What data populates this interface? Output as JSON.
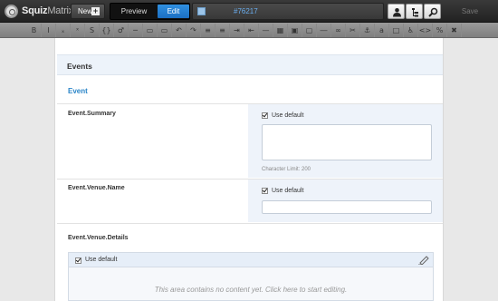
{
  "app": {
    "logo_bold": "Squiz",
    "logo_thin": "Matrix"
  },
  "topbar": {
    "new_label": "New",
    "preview_label": "Preview",
    "edit_label": "Edit",
    "asset_id": "#76217",
    "save_label": "Save",
    "icons": [
      "user-icon",
      "tree-icon",
      "search-icon"
    ]
  },
  "wysiwyg": {
    "buttons": [
      "B",
      "I",
      "ₓ",
      "ˣ",
      "S",
      "{}",
      "♂",
      "─",
      "▭",
      "▭",
      "↶",
      "↷",
      "≡",
      "≡",
      "⇥",
      "⇤",
      "—",
      "▦",
      "▣",
      "▢",
      "―",
      "∞",
      "✂",
      "⚓",
      "a",
      "□",
      "♿",
      "<>",
      "%",
      "✖"
    ]
  },
  "page": {
    "section_title": "Events",
    "subsection_title": "Event",
    "fields": {
      "summary": {
        "label": "Event.Summary",
        "checkbox_label": "Use default",
        "char_limit": "Character Limit: 200"
      },
      "venue_name": {
        "label": "Event.Venue.Name",
        "checkbox_label": "Use default"
      },
      "venue_details": {
        "label": "Event.Venue.Details",
        "checkbox_label": "Use default",
        "empty_message": "This area contains no content yet. Click here to start editing."
      }
    }
  },
  "colors": {
    "accent": "#2a85c8",
    "edit_button": "#1b6fc2",
    "panel_bg": "#eef3fa"
  }
}
